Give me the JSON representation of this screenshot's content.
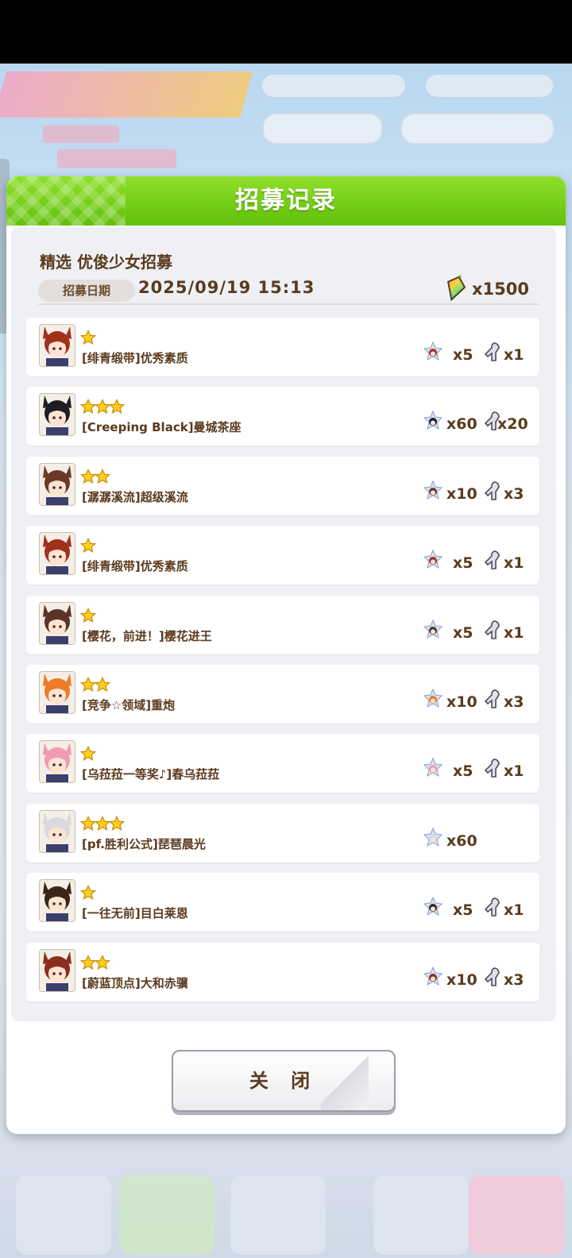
{
  "dialog": {
    "title": "招募记录",
    "gacha_name": "精选 优俊少女招募",
    "date_label": "招募日期",
    "date_value": "2025/09/19  15:13",
    "cost": "x1500",
    "close_label": "关 闭"
  },
  "records": [
    {
      "stars": 1,
      "name": "[绯青缎带]优秀素质",
      "pieces": "x5",
      "shoes": "x1",
      "hair": "#a2311c"
    },
    {
      "stars": 3,
      "name": "[Creeping Black]曼城茶座",
      "pieces": "x60",
      "shoes": "x20",
      "hair": "#1e1d26"
    },
    {
      "stars": 2,
      "name": "[潺潺溪流]超级溪流",
      "pieces": "x10",
      "shoes": "x3",
      "hair": "#6b3a26"
    },
    {
      "stars": 1,
      "name": "[绯青缎带]优秀素质",
      "pieces": "x5",
      "shoes": "x1",
      "hair": "#a2311c"
    },
    {
      "stars": 1,
      "name": "[樱花，前进！]樱花进王",
      "pieces": "x5",
      "shoes": "x1",
      "hair": "#5a3424"
    },
    {
      "stars": 2,
      "name": "[竞争☆领域]重炮",
      "pieces": "x10",
      "shoes": "x3",
      "hair": "#ee7a2a"
    },
    {
      "stars": 1,
      "name": "[乌菈菈一等奖♪]春乌菈菈",
      "pieces": "x5",
      "shoes": "x1",
      "hair": "#f09bb3"
    },
    {
      "stars": 3,
      "name": "[pf.胜利公式]琵琶晨光",
      "pieces": "x60",
      "shoes": "",
      "hair": "#d9d9de"
    },
    {
      "stars": 1,
      "name": "[一往无前]目白莱恩",
      "pieces": "x5",
      "shoes": "x1",
      "hair": "#3a2618"
    },
    {
      "stars": 2,
      "name": "[蔚蓝顶点]大和赤骥",
      "pieces": "x10",
      "shoes": "x3",
      "hair": "#8c2e1c"
    }
  ],
  "icons": {
    "star": "star-icon",
    "piece": "uma-piece-icon",
    "shoe": "horseshoe-icon",
    "carat": "carat-icon"
  },
  "colors": {
    "header_green": "#6cc814",
    "text_brown": "#5a3a1e",
    "star_gold": "#ffcf1f"
  }
}
